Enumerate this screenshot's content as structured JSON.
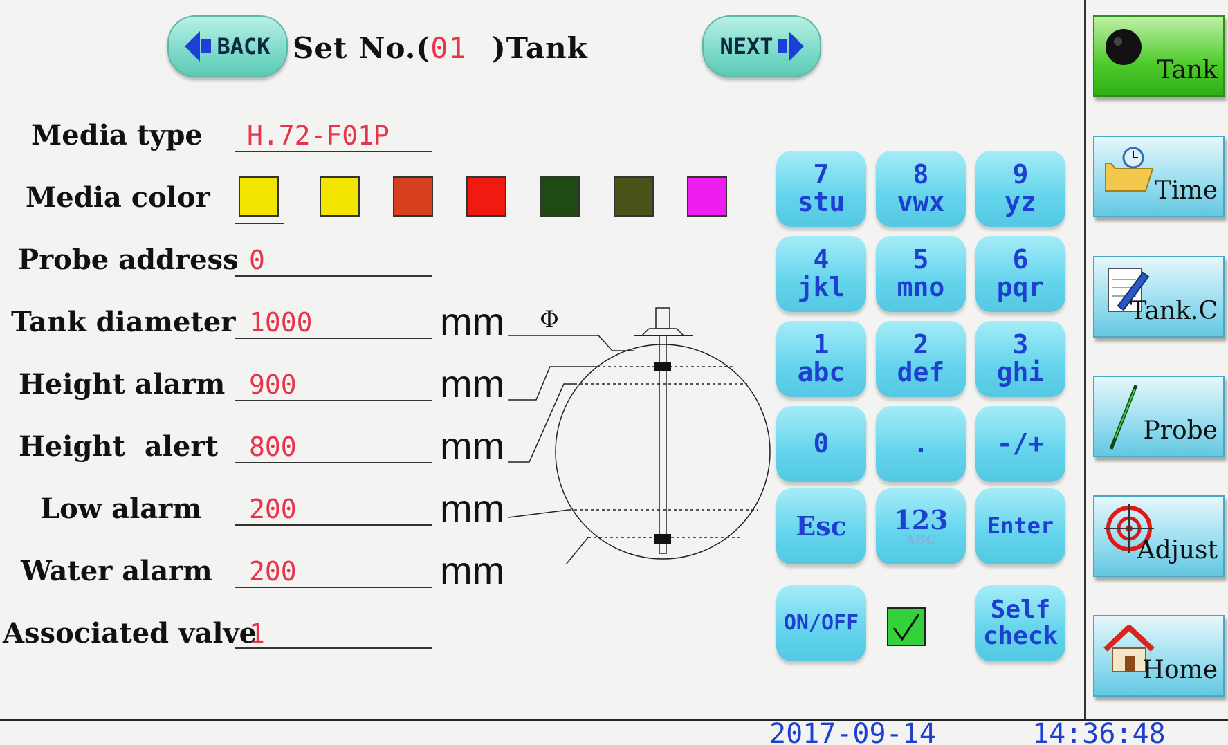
{
  "header": {
    "back_label": "BACK",
    "next_label": "NEXT",
    "set_prefix": "Set No.(",
    "set_number": "01",
    "set_suffix": ")Tank"
  },
  "form": {
    "media_type": {
      "label": "Media type",
      "value": "H.72-F01P"
    },
    "media_color": {
      "label": "Media color",
      "swatches": [
        "#f2e600",
        "#f2e600",
        "#d6401e",
        "#f01a10",
        "#1f4a14",
        "#4a5218",
        "#ee1ef0"
      ]
    },
    "probe_address": {
      "label": "Probe address",
      "value": "0"
    },
    "tank_diameter": {
      "label": "Tank diameter",
      "value": "1000",
      "unit": "mm"
    },
    "height_alarm": {
      "label": "Height alarm",
      "value": "900",
      "unit": "mm"
    },
    "height_alert": {
      "label": "Height  alert",
      "value": "800",
      "unit": "mm"
    },
    "low_alarm": {
      "label": "Low alarm",
      "value": "200",
      "unit": "mm"
    },
    "water_alarm": {
      "label": "Water alarm",
      "value": "200",
      "unit": "mm"
    },
    "associated_valve": {
      "label": "Associated valve",
      "value": "1"
    }
  },
  "diagram": {
    "diameter_symbol": "Φ"
  },
  "keypad": {
    "k7": {
      "num": "7",
      "letters": "stu"
    },
    "k8": {
      "num": "8",
      "letters": "vwx"
    },
    "k9": {
      "num": "9",
      "letters": "yz"
    },
    "k4": {
      "num": "4",
      "letters": "jkl"
    },
    "k5": {
      "num": "5",
      "letters": "mno"
    },
    "k6": {
      "num": "6",
      "letters": "pqr"
    },
    "k1": {
      "num": "1",
      "letters": "abc"
    },
    "k2": {
      "num": "2",
      "letters": "def"
    },
    "k3": {
      "num": "3",
      "letters": "ghi"
    },
    "k0": "0",
    "dot": ".",
    "sign": "-/+",
    "esc": "Esc",
    "mode": {
      "main": "123",
      "sub": "ABC"
    },
    "enter": "Enter",
    "onoff": "ON/OFF",
    "onoff_checked": true,
    "selfcheck_line1": "Self",
    "selfcheck_line2": "check"
  },
  "sidebar": {
    "items": [
      {
        "label": "Tank",
        "icon": "tank-sphere-icon",
        "active": true
      },
      {
        "label": "Time",
        "icon": "folder-clock-icon",
        "active": false
      },
      {
        "label": "Tank.C",
        "icon": "notepad-pen-icon",
        "active": false
      },
      {
        "label": "Probe",
        "icon": "probe-rod-icon",
        "active": false
      },
      {
        "label": "Adjust",
        "icon": "target-icon",
        "active": false
      },
      {
        "label": "Home",
        "icon": "house-icon",
        "active": false
      }
    ]
  },
  "status": {
    "date": "2017-09-14",
    "time": "14:36:48"
  },
  "colors": {
    "value_red": "#e8344a",
    "key_blue": "#1f3fd0",
    "active_green": "#4ecb2c"
  }
}
